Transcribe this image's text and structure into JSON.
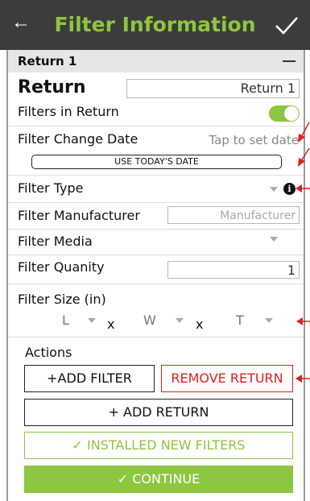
{
  "header": {
    "title": "Filter Information"
  },
  "section": {
    "label": "Return 1"
  },
  "return": {
    "label": "Return",
    "value": "Return 1"
  },
  "filters_in_return": {
    "label": "Filters in Return",
    "enabled": true
  },
  "filter_change_date": {
    "label": "Filter Change Date",
    "value": "Tap to set date",
    "button": "USE TODAY'S DATE"
  },
  "filter_type": {
    "label": "Filter Type"
  },
  "filter_manufacturer": {
    "label": "Filter Manufacturer",
    "placeholder": "Manufacturer"
  },
  "filter_media": {
    "label": "Filter Media"
  },
  "filter_quantity": {
    "label": "Filter Quanity",
    "value": "1"
  },
  "filter_size": {
    "label": "Filter Size  (in)",
    "l": "L",
    "w": "W",
    "t": "T",
    "x": "x"
  },
  "actions": {
    "label": "Actions",
    "add_filter": "+ADD FILTER",
    "remove_return": "REMOVE RETURN",
    "add_return": "+ ADD RETURN",
    "installed_new_filters": "✓ INSTALLED NEW FILTERS",
    "continue": "✓ CONTINUE"
  },
  "colors": {
    "accent": "#8dc63f",
    "header_bg": "#3c3c3c",
    "danger": "#e02020"
  }
}
